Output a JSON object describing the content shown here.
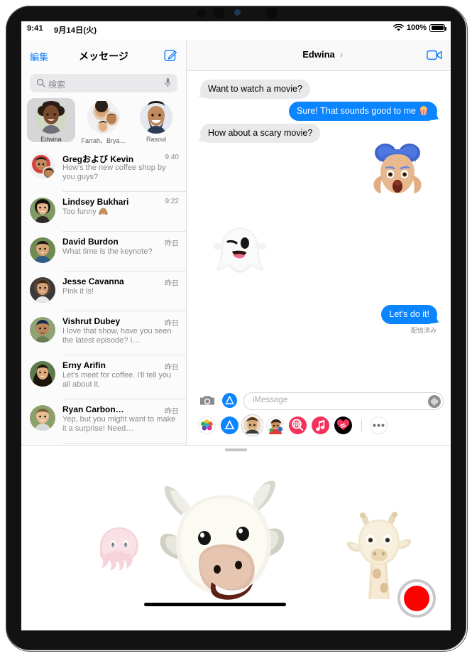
{
  "status_bar": {
    "time": "9:41",
    "date": "9月14日(火)",
    "battery_pct": "100%",
    "wifi_icon": "wifi-icon",
    "battery_icon": "battery-icon"
  },
  "multitasking_handle": "multitasking-dots",
  "sidebar": {
    "edit_label": "編集",
    "title": "メッセージ",
    "compose_icon": "compose-icon",
    "search": {
      "placeholder": "検索",
      "search_icon": "search-icon",
      "mic_icon": "microphone-icon"
    },
    "pinned": [
      {
        "name": "Edwina",
        "selected": true,
        "avatar": "photo-woman-curly-hair"
      },
      {
        "name": "Farrah、Brya…",
        "selected": false,
        "avatar": "group-photo-three-people"
      },
      {
        "name": "Rasoul",
        "selected": false,
        "avatar": "photo-man-beard"
      }
    ],
    "conversations": [
      {
        "name": "Gregおよび Kevin",
        "time": "9:40",
        "preview": "How's the new coffee shop by you guys?",
        "avatar": "group-photo-two-men"
      },
      {
        "name": "Lindsey Bukhari",
        "time": "9:22",
        "preview": "Too funny 🙈",
        "avatar": "photo-woman-dark-hair"
      },
      {
        "name": "David Burdon",
        "time": "昨日",
        "preview": "What time is the keynote?",
        "avatar": "photo-man-blue-jacket"
      },
      {
        "name": "Jesse Cavanna",
        "time": "昨日",
        "preview": "Pink it is!",
        "avatar": "photo-person-smiling"
      },
      {
        "name": "Vishrut Dubey",
        "time": "昨日",
        "preview": "I love that show, have you seen the latest episode? I…",
        "avatar": "photo-man-dark-hair"
      },
      {
        "name": "Erny Arifin",
        "time": "昨日",
        "preview": "Let's meet for coffee. I'll tell you all about it.",
        "avatar": "photo-woman-long-hair"
      },
      {
        "name": "Ryan Carbon…",
        "time": "昨日",
        "preview": "Yep, but you might want to make it a surprise! Need…",
        "avatar": "photo-man-light-hair"
      }
    ]
  },
  "detail": {
    "title": "Edwina",
    "title_chevron": "chevron-right-icon",
    "facetime_icon": "video-camera-icon",
    "messages": [
      {
        "id": "m1",
        "from": "them",
        "type": "text",
        "text": "Want to watch a movie?"
      },
      {
        "id": "m2",
        "from": "me",
        "type": "text",
        "text": "Sure! That sounds good to me 🍿"
      },
      {
        "id": "m3",
        "from": "them",
        "type": "text",
        "text": "How about a scary movie?"
      },
      {
        "id": "m4",
        "from": "me",
        "type": "sticker",
        "sticker": "memoji-shocked-blue-hair"
      },
      {
        "id": "m5",
        "from": "them",
        "type": "sticker",
        "sticker": "memoji-ghost-winking"
      },
      {
        "id": "m6",
        "from": "me",
        "type": "text",
        "text": "Let's do it!"
      }
    ],
    "delivery_status": "配信済み",
    "input": {
      "placeholder": "iMessage",
      "camera_icon": "camera-icon",
      "appstore_icon": "app-store-icon",
      "audio_icon": "audio-message-icon"
    },
    "app_tray": [
      {
        "name": "photos-app-icon",
        "selected": false
      },
      {
        "name": "app-store-app-icon",
        "selected": false
      },
      {
        "name": "memoji-app-icon",
        "selected": true
      },
      {
        "name": "memoji-stickers-app-icon",
        "selected": false
      },
      {
        "name": "images-search-app-icon",
        "selected": false
      },
      {
        "name": "music-app-icon",
        "selected": false
      },
      {
        "name": "digital-touch-app-icon",
        "selected": false
      },
      {
        "name": "more-apps-icon",
        "selected": false
      }
    ]
  },
  "memoji_panel": {
    "grabber": "drag-handle",
    "characters": [
      {
        "name": "octopus-memoji",
        "position": "left"
      },
      {
        "name": "cow-memoji",
        "position": "center",
        "active": true
      },
      {
        "name": "giraffe-memoji",
        "position": "right"
      }
    ],
    "record_button": "record-button"
  },
  "home_indicator": "home-indicator",
  "colors": {
    "accent_blue": "#0a84ff",
    "link_blue": "#0a7cff",
    "bubble_gray": "#e9e9eb",
    "record_red": "#ff0000",
    "secondary_text": "#8a8a8e"
  }
}
